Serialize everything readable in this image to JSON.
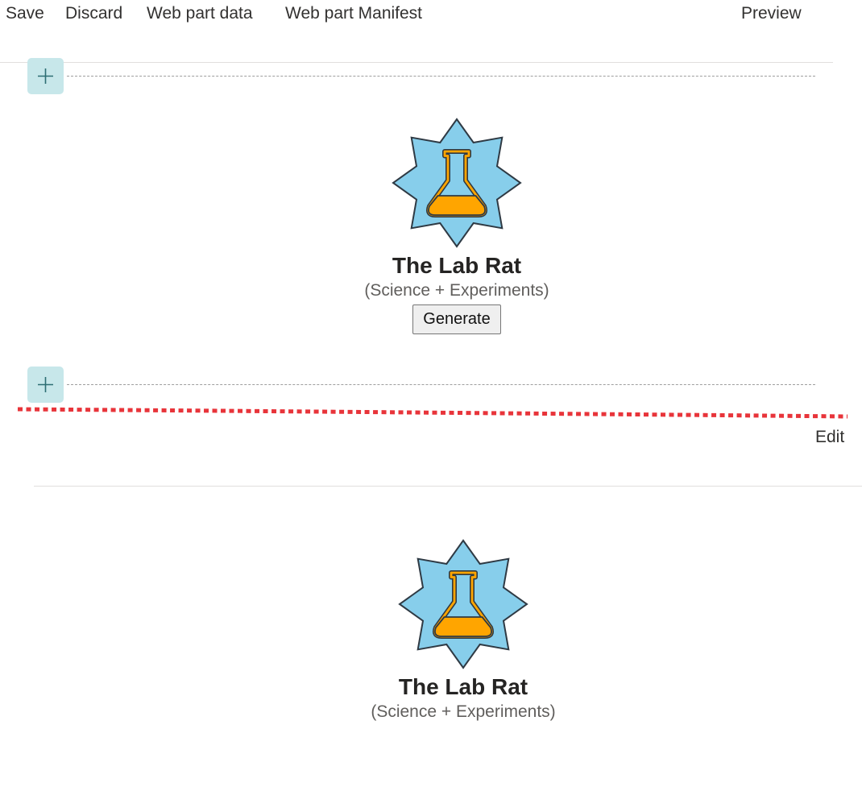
{
  "toolbar": {
    "save_label": "Save",
    "discard_label": "Discard",
    "webpart_data_label": "Web part data",
    "webpart_manifest_label": "Web part Manifest",
    "preview_label": "Preview"
  },
  "edit_view": {
    "webpart": {
      "title": "The Lab Rat",
      "subtitle": "(Science + Experiments)",
      "icon": "science-flask-star-icon",
      "generate_label": "Generate"
    }
  },
  "preview_view": {
    "edit_label": "Edit",
    "webpart": {
      "title": "The Lab Rat",
      "subtitle": "(Science + Experiments)",
      "icon": "science-flask-star-icon"
    }
  },
  "colors": {
    "star_fill": "#87ceeb",
    "flask_liquid": "#ffa500",
    "outline": "#2f3a44",
    "add_button_bg": "#c7e7ea",
    "divider_red": "#e8343a"
  }
}
